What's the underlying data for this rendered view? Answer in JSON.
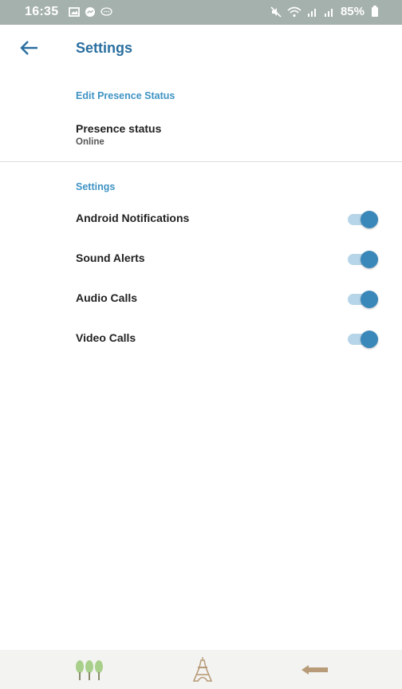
{
  "status_bar": {
    "time": "16:35",
    "battery": "85%",
    "left_icons": [
      "gallery-icon",
      "messenger-icon",
      "chat-icon"
    ],
    "right_icons": [
      "mute-icon",
      "wifi-icon",
      "signal-icon",
      "signal-icon",
      "battery-icon"
    ]
  },
  "header": {
    "back_icon": "arrow-left-icon",
    "title": "Settings"
  },
  "presence_section": {
    "label": "Edit Presence Status",
    "item_title": "Presence status",
    "item_value": "Online"
  },
  "settings_section": {
    "label": "Settings",
    "items": [
      {
        "label": "Android Notifications",
        "enabled": true
      },
      {
        "label": "Sound Alerts",
        "enabled": true
      },
      {
        "label": "Audio Calls",
        "enabled": true
      },
      {
        "label": "Video Calls",
        "enabled": true
      }
    ]
  },
  "colors": {
    "accent": "#3a87ba",
    "title": "#2a6fa0",
    "status_bar": "#a5b1ac"
  },
  "nav_bar": {
    "buttons": [
      "trees-icon",
      "eiffel-tower-icon",
      "back-arrow-icon"
    ]
  }
}
